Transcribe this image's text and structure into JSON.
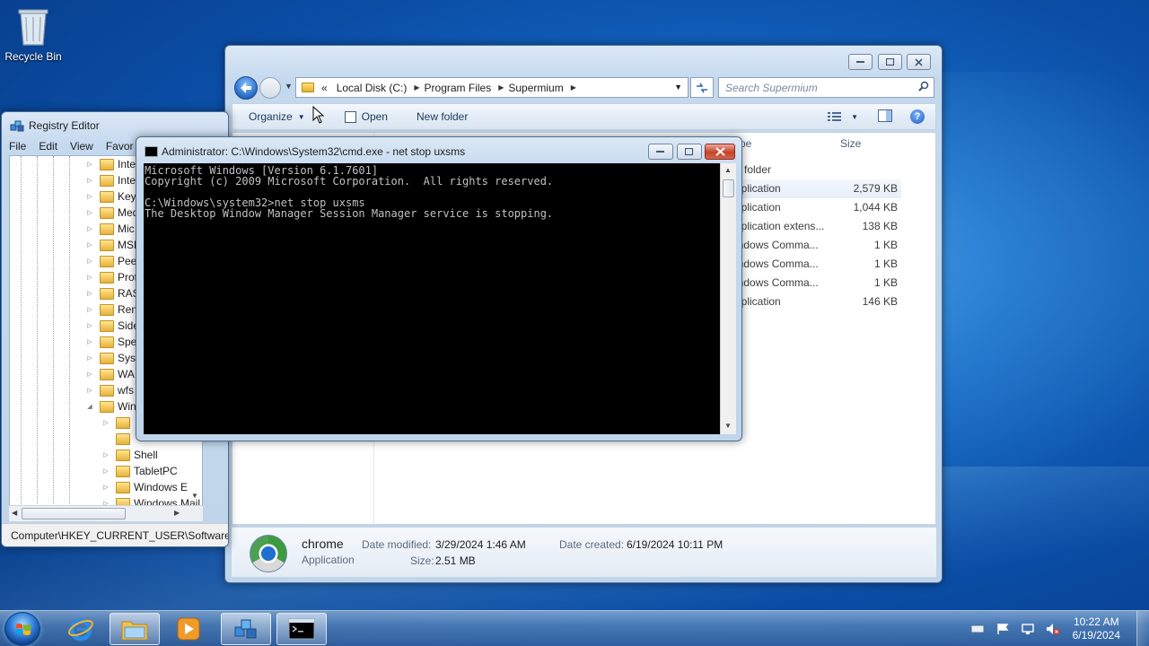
{
  "desktop": {
    "recycle_bin_label": "Recycle Bin"
  },
  "explorer": {
    "address": {
      "prefix": "«",
      "crumbs": [
        "Local Disk (C:)",
        "Program Files",
        "Supermium"
      ]
    },
    "search_placeholder": "Search Supermium",
    "toolbar": {
      "organize": "Organize",
      "open": "Open",
      "new_folder": "New folder"
    },
    "columns": {
      "type": "pe",
      "size": "Size"
    },
    "rows": [
      {
        "type": "e folder",
        "size": ""
      },
      {
        "type": "pplication",
        "size": "2,579 KB"
      },
      {
        "type": "pplication",
        "size": "1,044 KB"
      },
      {
        "type": "pplication extens...",
        "size": "138 KB"
      },
      {
        "type": "indows Comma...",
        "size": "1 KB"
      },
      {
        "type": "indows Comma...",
        "size": "1 KB"
      },
      {
        "type": "indows Comma...",
        "size": "1 KB"
      },
      {
        "type": "pplication",
        "size": "146 KB"
      }
    ],
    "details": {
      "name": "chrome",
      "type": "Application",
      "date_modified_label": "Date modified:",
      "date_modified": "3/29/2024 1:46 AM",
      "date_created_label": "Date created:",
      "date_created": "6/19/2024 10:11 PM",
      "size_label": "Size:",
      "size": "2.51 MB"
    }
  },
  "regedit": {
    "title": "Registry Editor",
    "menu": [
      "File",
      "Edit",
      "View",
      "Favor"
    ],
    "tree": [
      "Inte",
      "Inte",
      "Key",
      "Med",
      "Mic",
      "MSF",
      "Pee",
      "Prot",
      "RAS",
      "Ren",
      "Side",
      "Spe",
      "Syst",
      "WA",
      "wfs",
      "Win",
      "",
      "",
      "Shell",
      "TabletPC",
      "Windows E",
      "Windows Mail"
    ],
    "status": "Computer\\HKEY_CURRENT_USER\\Software\\M"
  },
  "cmd": {
    "title": "Administrator: C:\\Windows\\System32\\cmd.exe - net  stop uxsms",
    "console": "Microsoft Windows [Version 6.1.7601]\nCopyright (c) 2009 Microsoft Corporation.  All rights reserved.\n\nC:\\Windows\\system32>net stop uxsms\nThe Desktop Window Manager Session Manager service is stopping."
  },
  "taskbar": {
    "time": "10:22 AM",
    "date": "6/19/2024"
  },
  "colors": {
    "close_button": "#c7432a",
    "console_bg": "#000000",
    "console_fg": "#c0c0c0"
  }
}
